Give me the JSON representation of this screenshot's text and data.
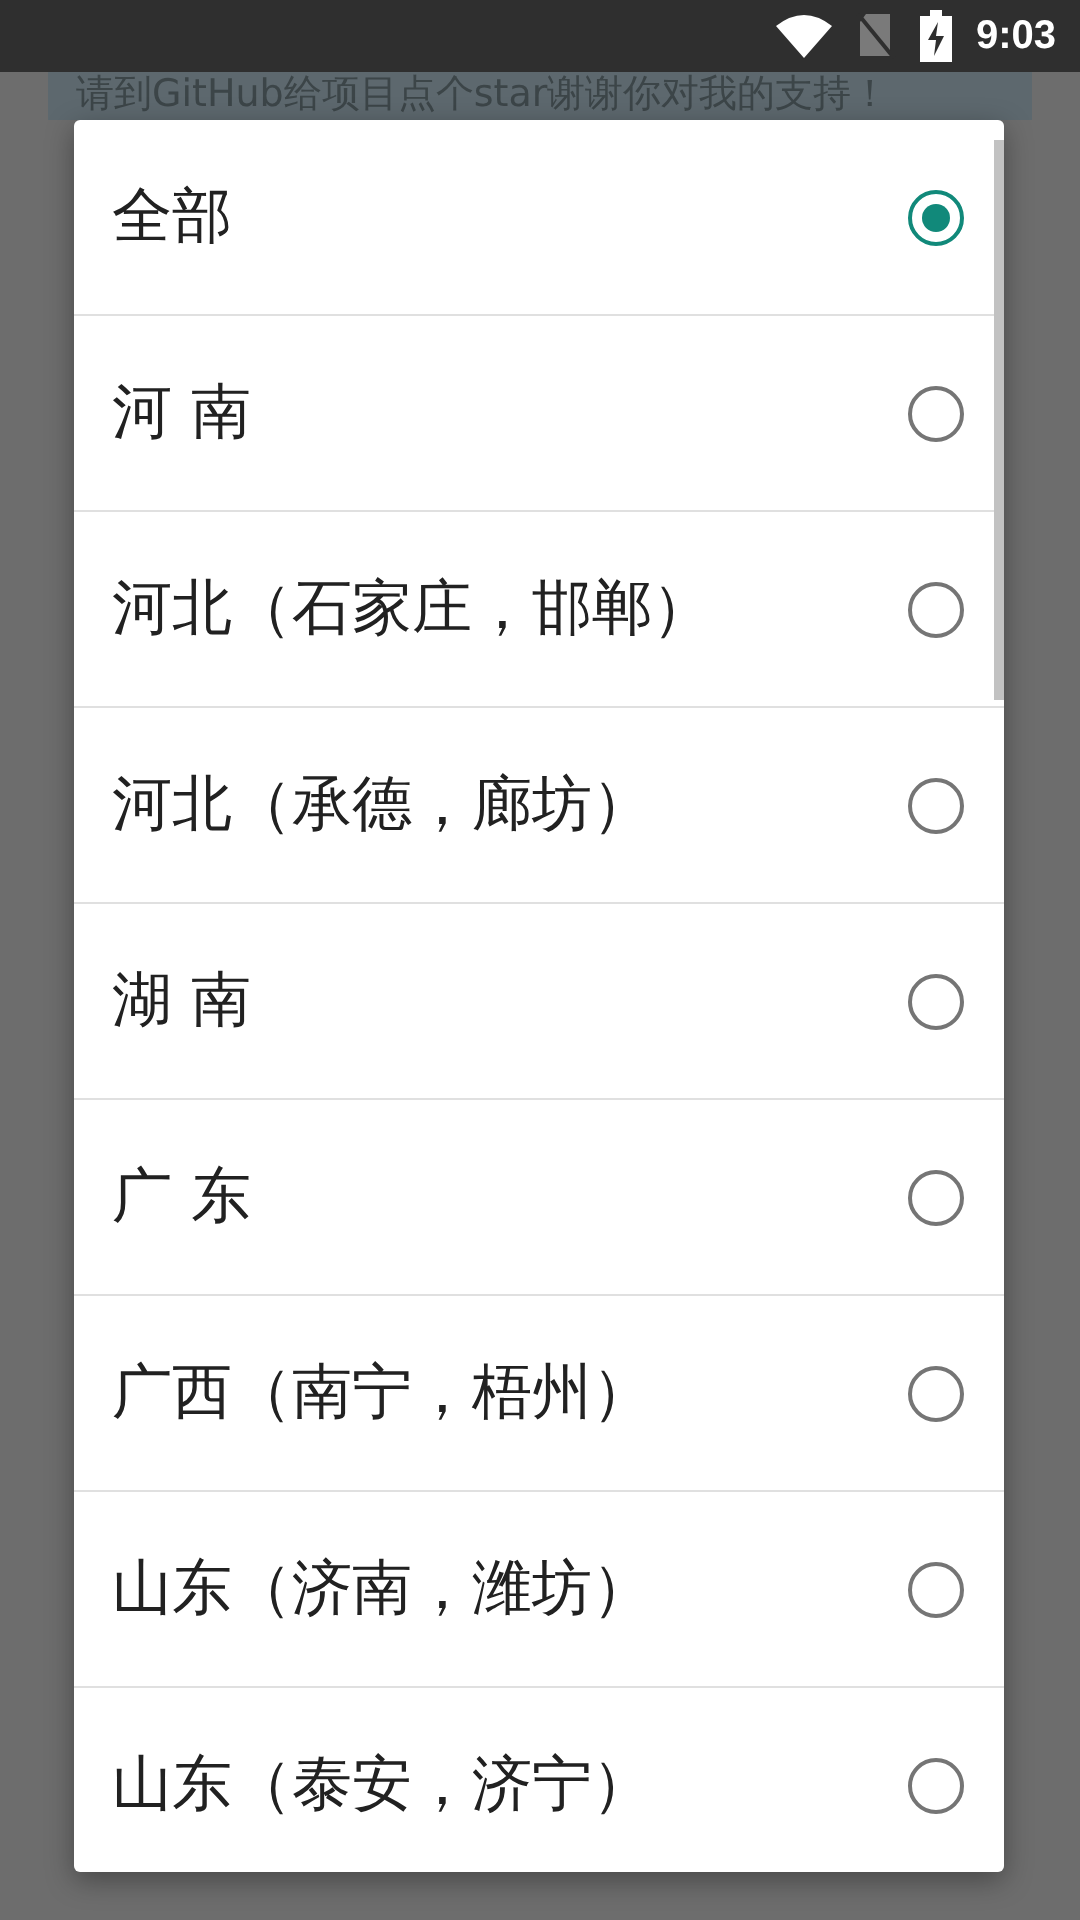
{
  "status_bar": {
    "time": "9:03"
  },
  "background": {
    "notice": "请到GitHub给项目点个star谢谢你对我的支持！"
  },
  "dialog": {
    "options": [
      {
        "label": "全部",
        "selected": true
      },
      {
        "label": "河 南",
        "selected": false
      },
      {
        "label": "河北（石家庄，邯郸）",
        "selected": false
      },
      {
        "label": "河北（承德，廊坊）",
        "selected": false
      },
      {
        "label": "湖 南",
        "selected": false
      },
      {
        "label": "广 东",
        "selected": false
      },
      {
        "label": "广西（南宁，梧州）",
        "selected": false
      },
      {
        "label": "山东（济南，潍坊）",
        "selected": false
      },
      {
        "label": "山东（泰安，济宁）",
        "selected": false
      }
    ]
  }
}
